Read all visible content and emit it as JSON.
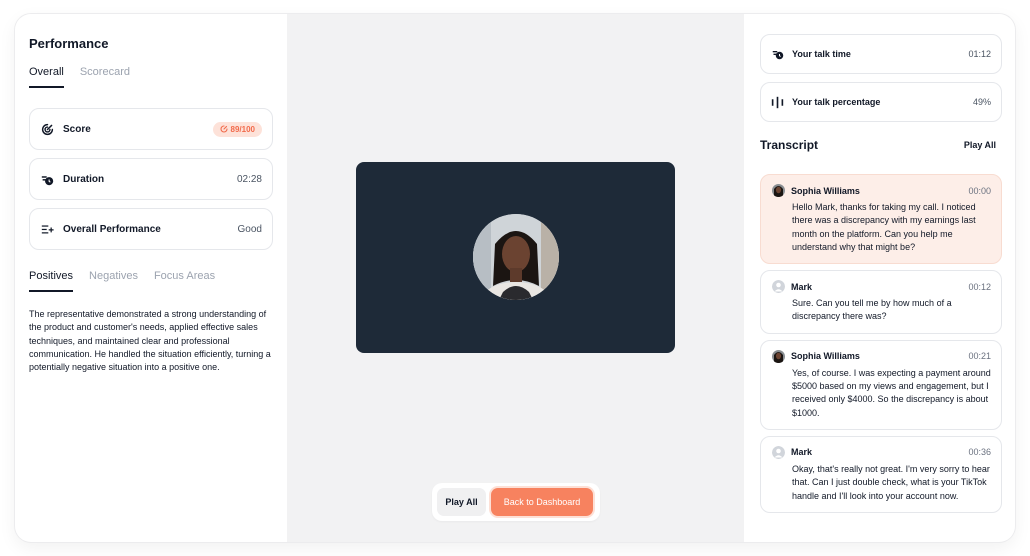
{
  "left": {
    "title": "Performance",
    "tabs": [
      {
        "label": "Overall"
      },
      {
        "label": "Scorecard"
      }
    ],
    "metrics": {
      "score": {
        "label": "Score",
        "value": "89/100"
      },
      "duration": {
        "label": "Duration",
        "value": "02:28"
      },
      "overall": {
        "label": "Overall Performance",
        "value": "Good"
      }
    },
    "subtabs": [
      {
        "label": "Positives"
      },
      {
        "label": "Negatives"
      },
      {
        "label": "Focus Areas"
      }
    ],
    "paragraph": "The representative demonstrated a strong understanding of the product and customer's needs, applied effective sales techniques, and maintained clear and professional communication. He handled the situation efficiently, turning a potentially negative situation into a positive one."
  },
  "center": {
    "controls": {
      "play_all": "Play All",
      "back": "Back to Dashboard"
    }
  },
  "right": {
    "stats": [
      {
        "icon": "clock-icon",
        "label": "Your talk time",
        "value": "01:12"
      },
      {
        "icon": "bars-icon",
        "label": "Your talk percentage",
        "value": "49%"
      }
    ],
    "transcript_title": "Transcript",
    "play_all": "Play All",
    "messages": [
      {
        "name": "Sophia Williams",
        "time": "00:00",
        "text": "Hello Mark, thanks for taking my call. I noticed there was a discrepancy with my earnings last month on the platform. Can you help me understand why that might be?"
      },
      {
        "name": "Mark",
        "time": "00:12",
        "text": "Sure. Can you tell me by how much of a discrepancy there was?"
      },
      {
        "name": "Sophia Williams",
        "time": "00:21",
        "text": "Yes, of course. I was expecting a payment around $5000 based on my views and engagement, but I received only $4000. So the discrepancy is about $1000."
      },
      {
        "name": "Mark",
        "time": "00:36",
        "text": "Okay, that's really not great. I'm very sorry to hear that. Can I just double check, what is your TikTok handle and I'll look into your account now."
      }
    ]
  },
  "colors": {
    "accent": "#f7825f",
    "video_bg": "#1e2a38",
    "highlight": "#fdeee8"
  }
}
